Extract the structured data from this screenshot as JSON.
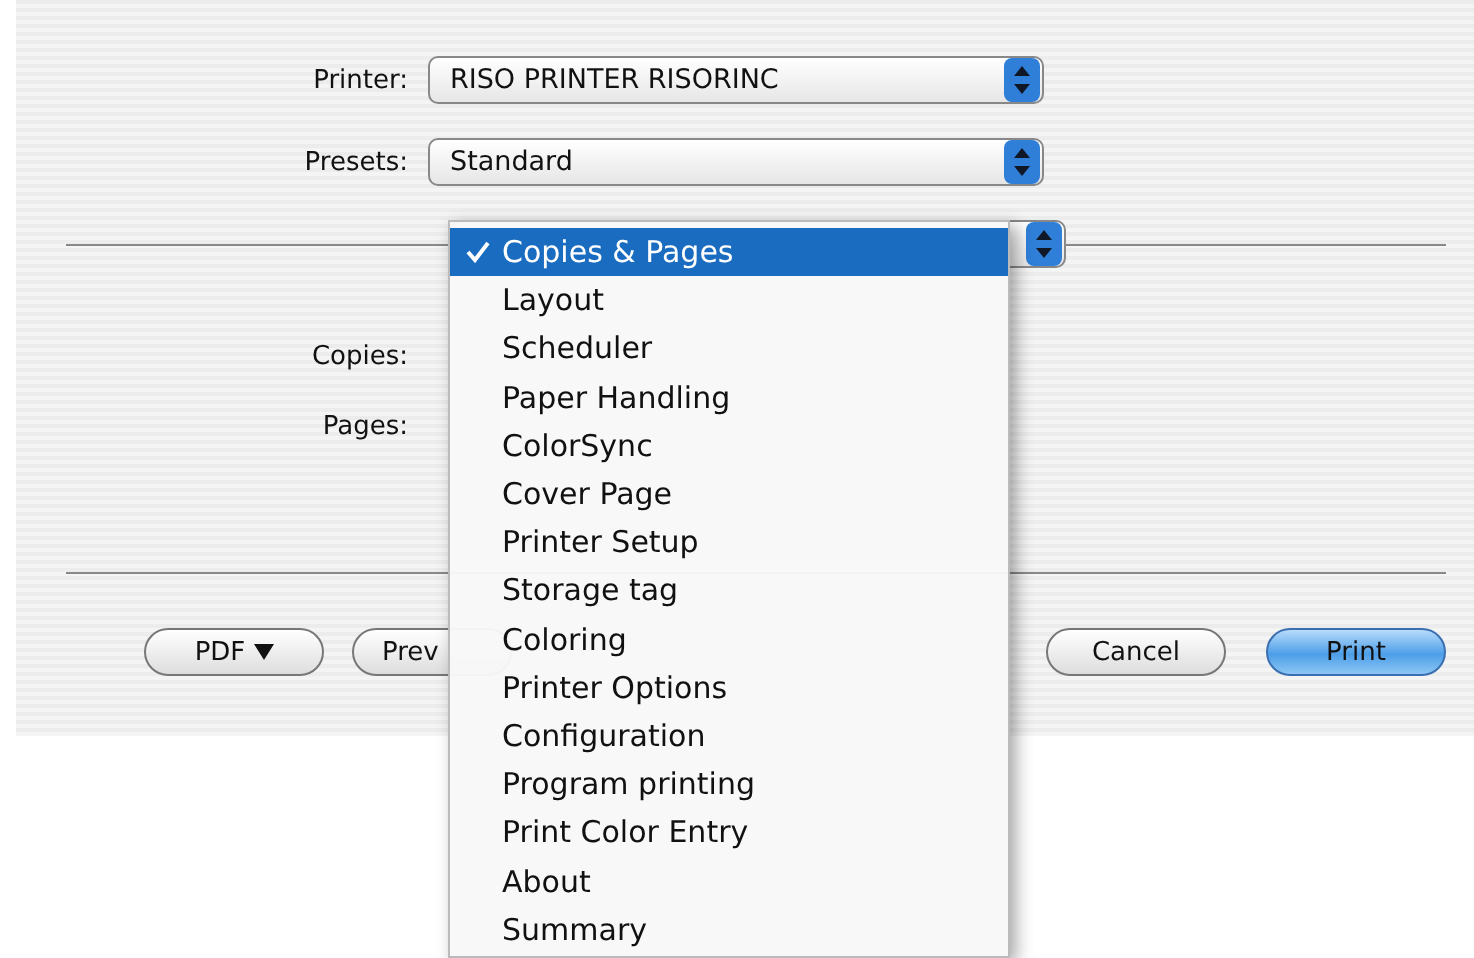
{
  "dialog": {
    "printer": {
      "label": "Printer:",
      "value": "RISO PRINTER RISORINC"
    },
    "presets": {
      "label": "Presets:",
      "value": "Standard"
    },
    "copies_label": "Copies:",
    "pages_label": "Pages:",
    "buttons": [
      {
        "label": "PDF",
        "kind": "menu"
      },
      {
        "label": "Prev",
        "kind": "plain"
      },
      {
        "label": "Cancel",
        "kind": "plain"
      },
      {
        "label": "Print",
        "kind": "default"
      }
    ]
  },
  "menu": {
    "items": [
      {
        "label": "Copies & Pages",
        "selected": true
      },
      {
        "label": "Layout",
        "selected": false
      },
      {
        "label": "Scheduler",
        "selected": false
      },
      {
        "label": "Paper Handling",
        "selected": false
      },
      {
        "label": "ColorSync",
        "selected": false
      },
      {
        "label": "Cover Page",
        "selected": false
      },
      {
        "label": "Printer Setup",
        "selected": false
      },
      {
        "label": "Storage tag",
        "selected": false
      },
      {
        "label": "Coloring",
        "selected": false
      },
      {
        "label": "Printer Options",
        "selected": false
      },
      {
        "label": "Configuration",
        "selected": false
      },
      {
        "label": "Program printing",
        "selected": false
      },
      {
        "label": "Print Color Entry",
        "selected": false
      },
      {
        "label": "About",
        "selected": false
      },
      {
        "label": "Summary",
        "selected": false
      }
    ]
  }
}
